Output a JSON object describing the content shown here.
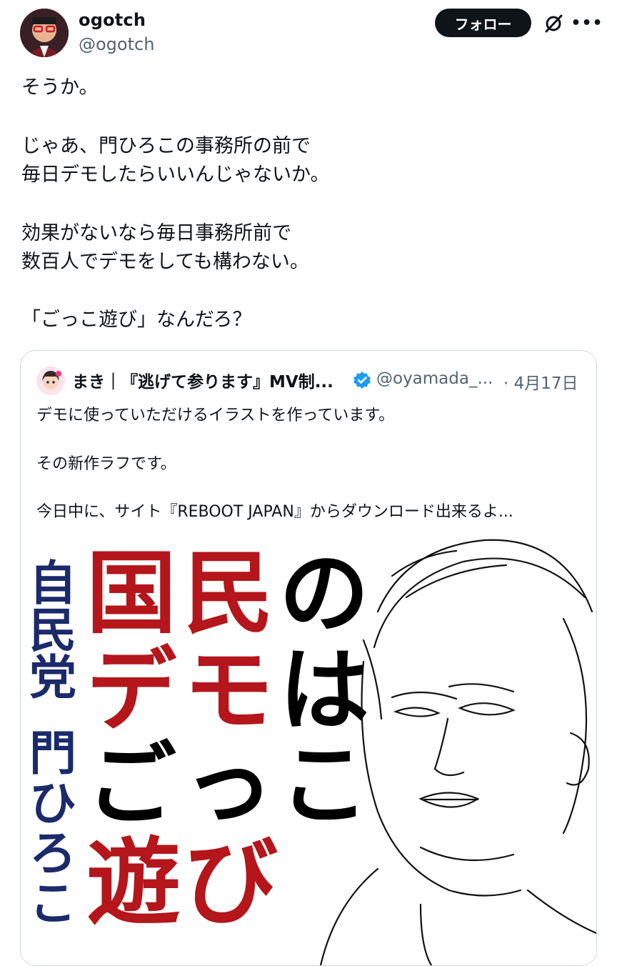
{
  "post": {
    "author_name": "ogotch",
    "author_handle": "@ogotch",
    "follow_label": "フォロー",
    "more_label": "•••",
    "icons": {
      "grok": "grok-icon",
      "more": "more-icon"
    },
    "body_lines": [
      "そうか。",
      "じゃあ、門ひろこの事務所の前で",
      "毎日デモしたらいいんじゃないか。",
      "効果がないなら毎日事務所前で",
      "数百人でデモをしても構わない。",
      "「ごっこ遊び」なんだろ？"
    ]
  },
  "quote": {
    "author_name": "まき｜『逃げて参ります』MV制...",
    "author_handle": "@oyamada_...",
    "date": "· 4月17日",
    "verified": true,
    "lines": [
      "デモに使っていただけるイラストを作っています。",
      "その新作ラフです。",
      "今日中に、サイト『REBOOT JAPAN』からダウンロード出来るよ..."
    ],
    "image_text": {
      "side_label": [
        "自",
        "民",
        "党",
        "門",
        "ひ",
        "ろ",
        "こ"
      ],
      "headline_rows": [
        [
          "国",
          "民",
          "の"
        ],
        [
          "デ",
          "モ",
          "は"
        ],
        [
          "ご",
          "っ",
          "こ"
        ],
        [
          "遊",
          "び"
        ]
      ]
    }
  },
  "colors": {
    "text": "#0f1419",
    "secondary": "#536471",
    "follow_bg": "#0f1419",
    "verified": "#1d9bf0",
    "poster_red": "#b4161b",
    "poster_navy": "#1b2a6b"
  }
}
